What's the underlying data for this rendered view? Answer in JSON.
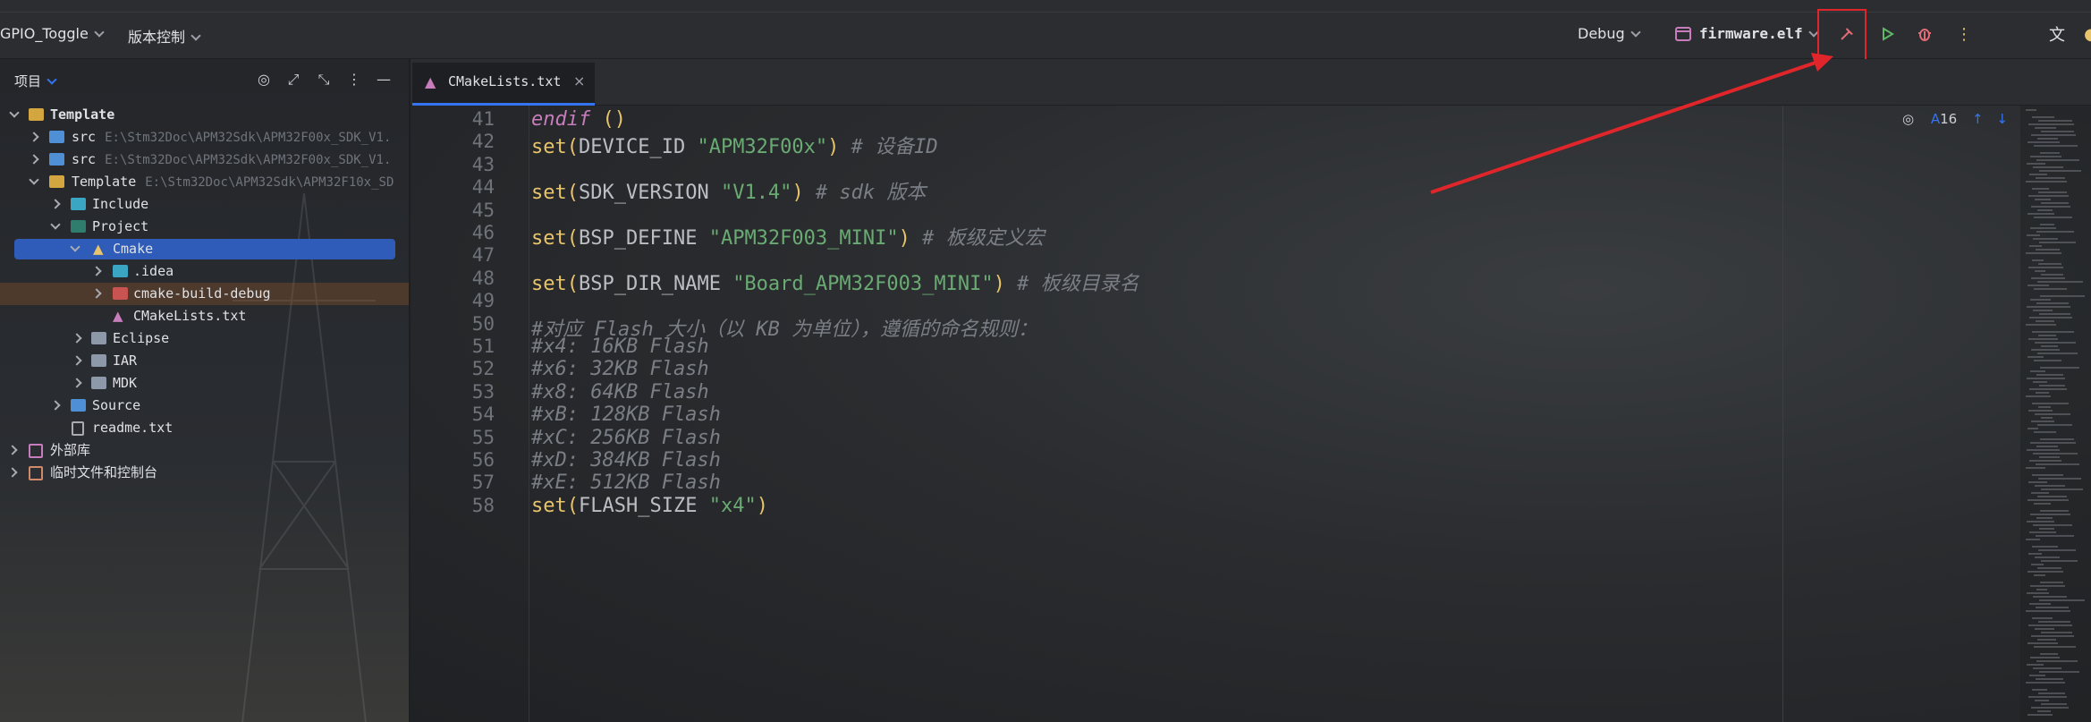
{
  "toolbar": {
    "project_name": "GPIO_Toggle",
    "vcs_label": "版本控制",
    "config": "Debug",
    "target": "firmware.elf"
  },
  "project_panel": {
    "title": "项目",
    "tree": [
      {
        "label": "Template",
        "path": ""
      },
      {
        "label": "src",
        "path": "E:\\Stm32Doc\\APM32Sdk\\APM32F00x_SDK_V1."
      },
      {
        "label": "src",
        "path": "E:\\Stm32Doc\\APM32Sdk\\APM32F00x_SDK_V1."
      },
      {
        "label": "Template",
        "path": "E:\\Stm32Doc\\APM32Sdk\\APM32F10x_SD"
      },
      {
        "label": "Include",
        "path": ""
      },
      {
        "label": "Project",
        "path": ""
      },
      {
        "label": "Cmake",
        "path": ""
      },
      {
        "label": ".idea",
        "path": ""
      },
      {
        "label": "cmake-build-debug",
        "path": ""
      },
      {
        "label": "CMakeLists.txt",
        "path": ""
      },
      {
        "label": "Eclipse",
        "path": ""
      },
      {
        "label": "IAR",
        "path": ""
      },
      {
        "label": "MDK",
        "path": ""
      },
      {
        "label": "Source",
        "path": ""
      },
      {
        "label": "readme.txt",
        "path": ""
      },
      {
        "label": "外部库",
        "path": ""
      },
      {
        "label": "临时文件和控制台",
        "path": ""
      }
    ]
  },
  "editor": {
    "tab_label": "CMakeLists.txt",
    "inspection_count": "16",
    "lines": [
      {
        "n": "41",
        "t": "endif"
      },
      {
        "n": "42",
        "fn": "set",
        "arg": "DEVICE_ID ",
        "str": "\"APM32F00x\"",
        "cm": "# 设备ID"
      },
      {
        "n": "43"
      },
      {
        "n": "44",
        "fn": "set",
        "arg": "SDK_VERSION ",
        "str": "\"V1.4\"",
        "cm": "# sdk 版本"
      },
      {
        "n": "45"
      },
      {
        "n": "46",
        "fn": "set",
        "arg": "BSP_DEFINE ",
        "str": "\"APM32F003_MINI\"",
        "cm": "# 板级定义宏"
      },
      {
        "n": "47"
      },
      {
        "n": "48",
        "fn": "set",
        "arg": "BSP_DIR_NAME ",
        "str": "\"Board_APM32F003_MINI\"",
        "cm": "# 板级目录名"
      },
      {
        "n": "49"
      },
      {
        "n": "50",
        "cmline": "#对应 Flash 大小（以 KB 为单位），遵循的命名规则："
      },
      {
        "n": "51",
        "cmline": "#x4: 16KB Flash"
      },
      {
        "n": "52",
        "cmline": "#x6: 32KB Flash"
      },
      {
        "n": "53",
        "cmline": "#x8: 64KB Flash"
      },
      {
        "n": "54",
        "cmline": "#xB: 128KB Flash"
      },
      {
        "n": "55",
        "cmline": "#xC: 256KB Flash"
      },
      {
        "n": "56",
        "cmline": "#xD: 384KB Flash"
      },
      {
        "n": "57",
        "cmline": "#xE: 512KB Flash"
      },
      {
        "n": "58",
        "fn": "set",
        "arg": "FLASH_SIZE ",
        "str": "\"x4\"",
        "cm": ""
      }
    ]
  },
  "colors": {
    "accent": "#3574f0",
    "annotation": "#e0262b"
  }
}
